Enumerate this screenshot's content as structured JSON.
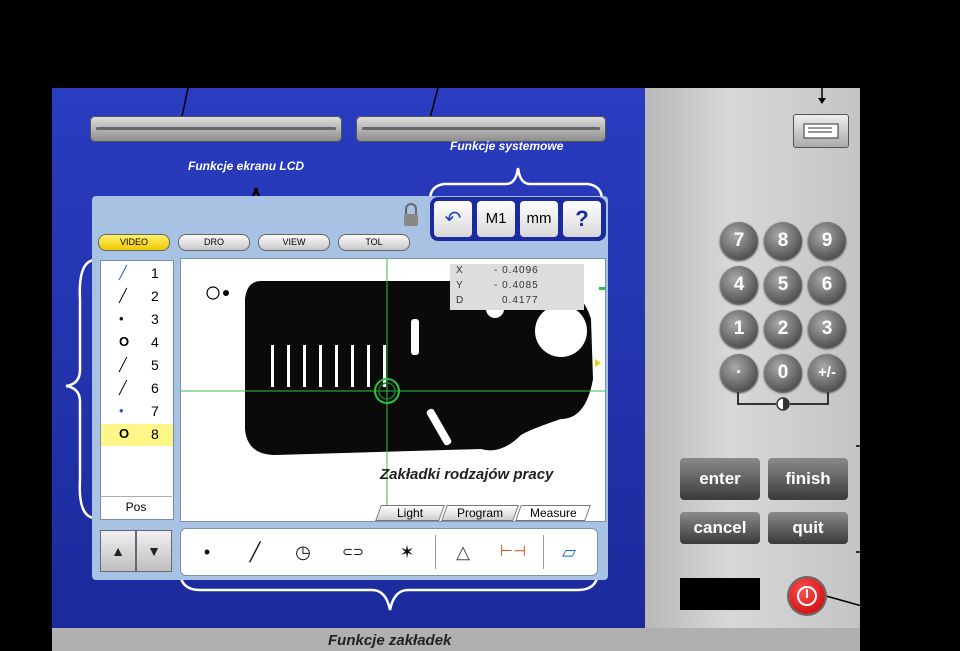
{
  "annotations": {
    "lcd_functions": "Funkcje ekranu LCD",
    "system_functions": "Funkcje systemowe",
    "mode_tabs": "Zakładki rodzajów pracy",
    "tab_functions": "Funkcje zakładek"
  },
  "lcd_tabs": [
    "VIDEO",
    "DRO",
    "VIEW",
    "TOL"
  ],
  "system_buttons": [
    "↶",
    "M1",
    "mm",
    "?"
  ],
  "features": [
    {
      "symbol": "╱",
      "number": "1"
    },
    {
      "symbol": "╱",
      "number": "2"
    },
    {
      "symbol": "•",
      "number": "3"
    },
    {
      "symbol": "O",
      "number": "4"
    },
    {
      "symbol": "╱",
      "number": "5"
    },
    {
      "symbol": "╱",
      "number": "6"
    },
    {
      "symbol": "•",
      "number": "7"
    },
    {
      "symbol": "O",
      "number": "8"
    }
  ],
  "feature_list_footer": "Pos",
  "dro": {
    "x_label": "X",
    "x_value": "- 0.4096",
    "y_label": "Y",
    "y_value": "- 0.4085",
    "d_label": "D",
    "d_value": "0.4177"
  },
  "mode_tabs": [
    "Light",
    "Program",
    "Measure"
  ],
  "nav_buttons": [
    "▲",
    "▼"
  ],
  "tools": [
    "•",
    "╱",
    "◷",
    "⊂⊃",
    "✶",
    "△",
    "⊢⊣",
    "▱"
  ],
  "keypad": [
    "7",
    "8",
    "9",
    "4",
    "5",
    "6",
    "1",
    "2",
    "3",
    "·",
    "0",
    "+/-"
  ],
  "action_keys": [
    "enter",
    "finish",
    "cancel",
    "quit"
  ],
  "colors": {
    "bezel": "#2a3cc0",
    "active_tab": "#f5d800",
    "power": "#e01010",
    "selected_row": "#fff68a"
  }
}
